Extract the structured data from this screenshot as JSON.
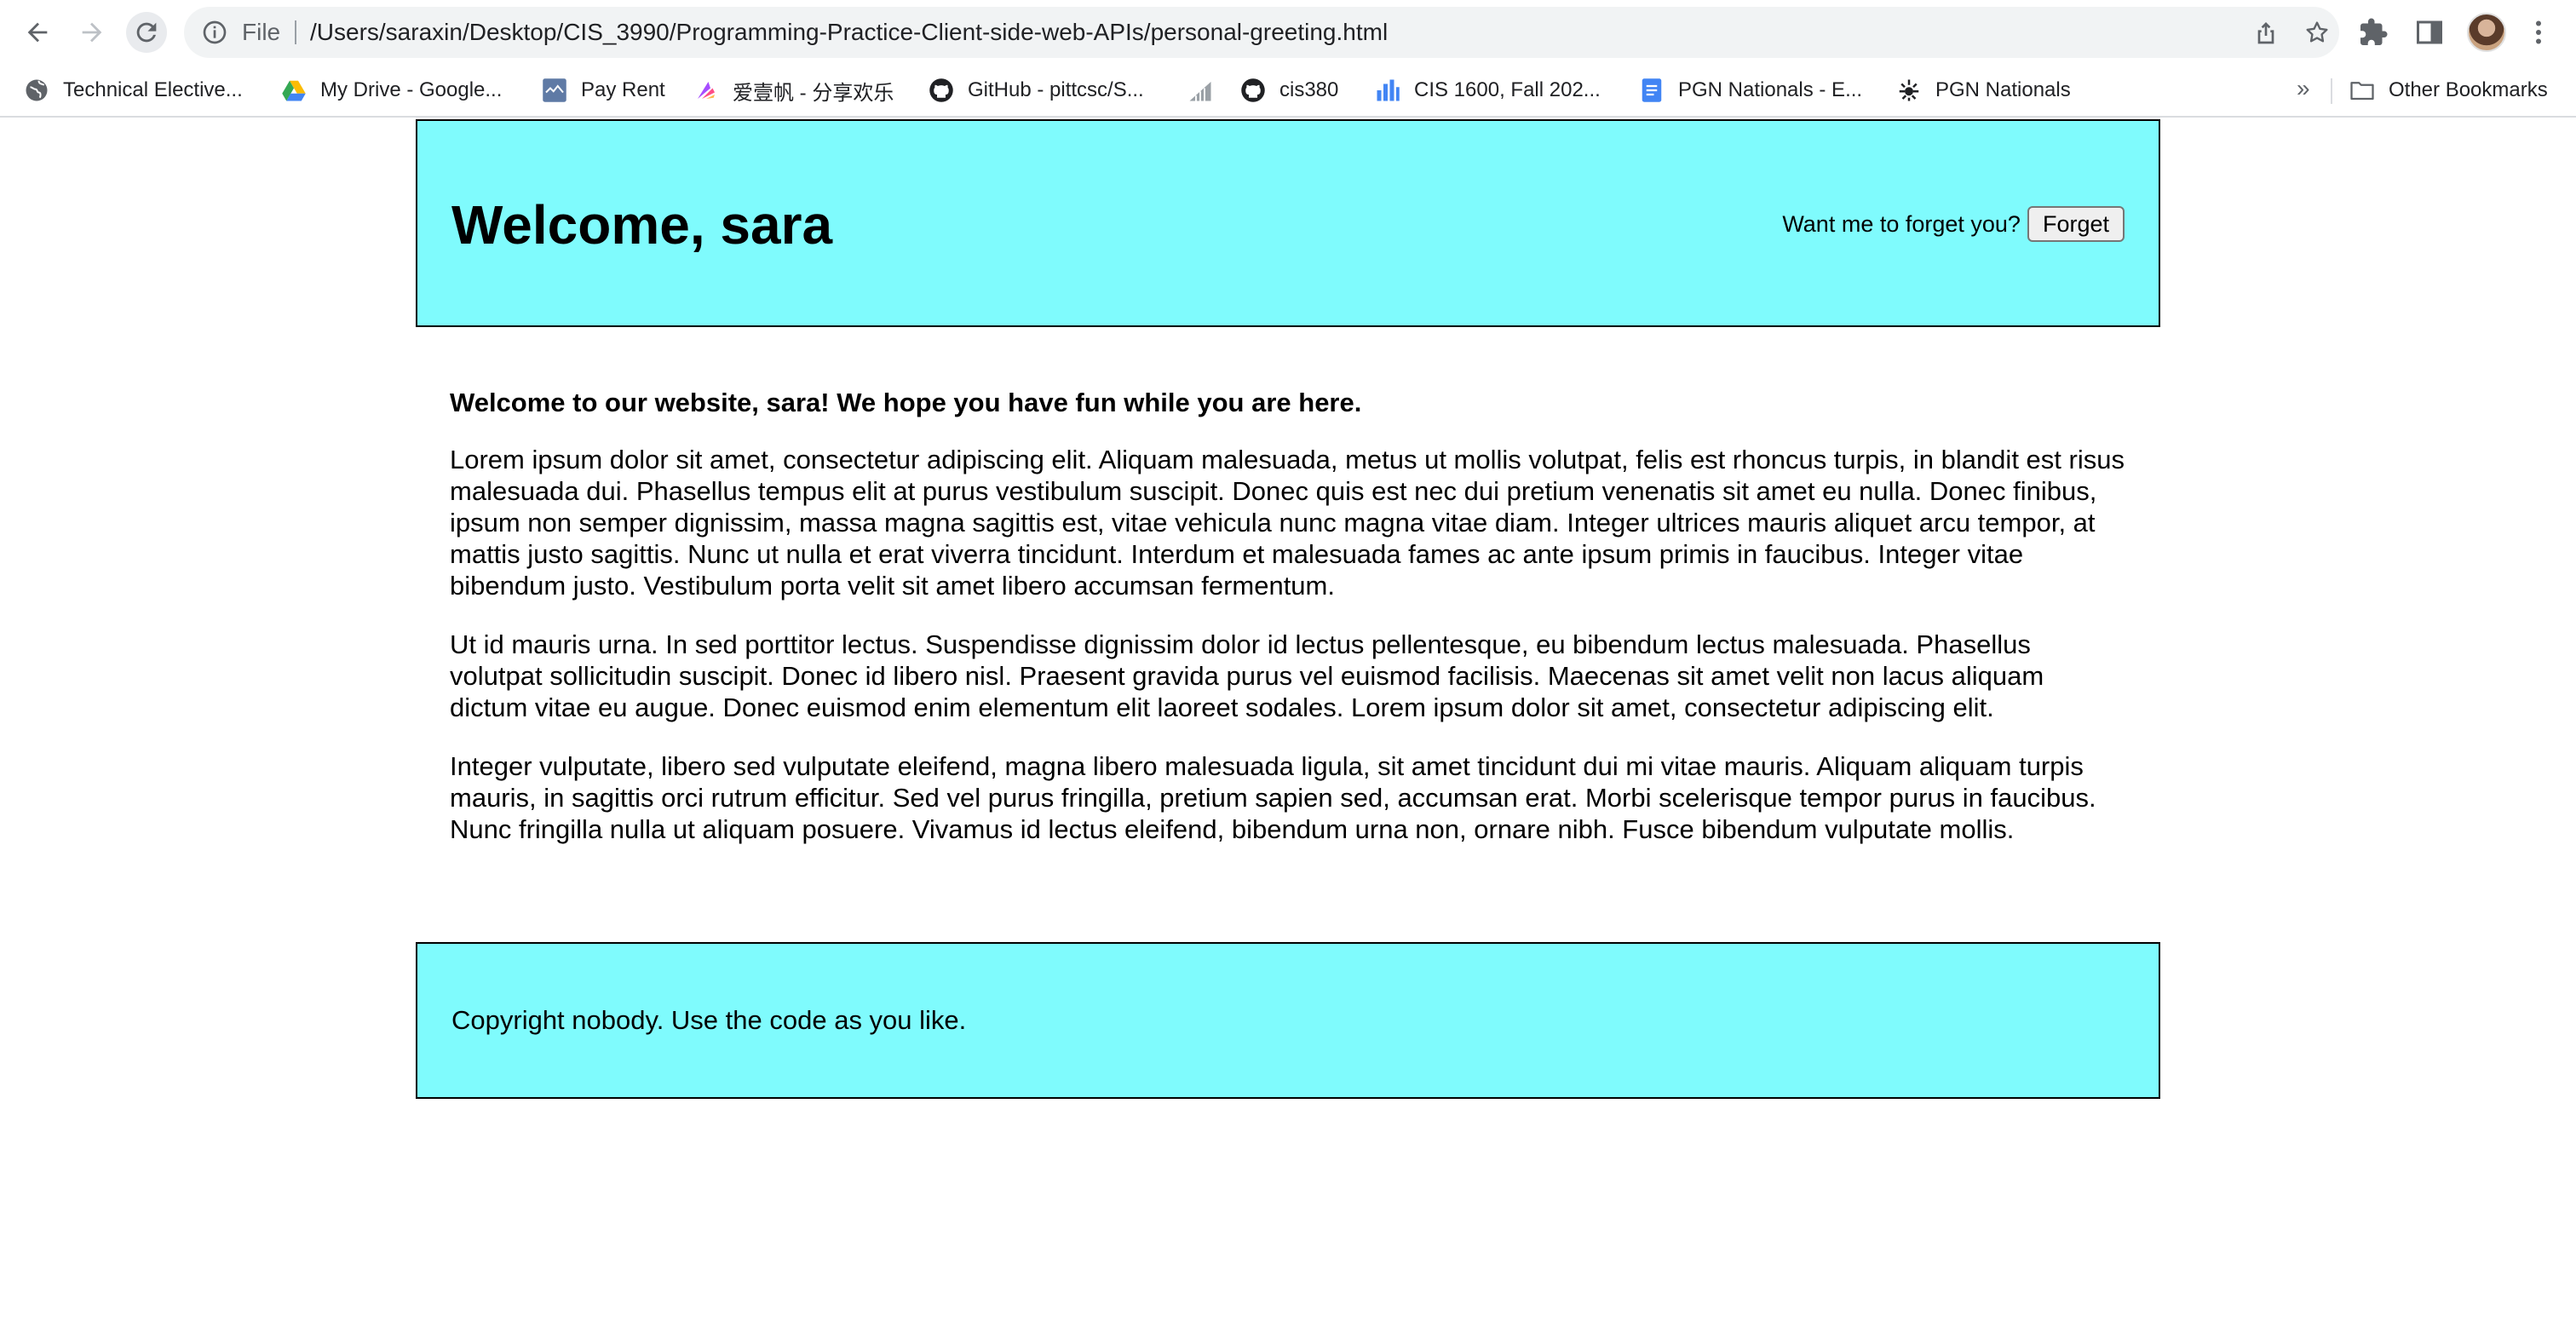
{
  "browser": {
    "omnibox": {
      "scheme_label": "File",
      "url": "/Users/saraxin/Desktop/CIS_3990/Programming-Practice-Client-side-web-APIs/personal-greeting.html"
    },
    "bookmarks": [
      {
        "label": "Technical Elective...",
        "icon": "globe-icon"
      },
      {
        "label": "My Drive - Google...",
        "icon": "google-drive-icon"
      },
      {
        "label": "Pay Rent",
        "icon": "pay-rent-icon"
      },
      {
        "label": "爱壹帆 - 分享欢乐",
        "icon": "aiyifan-icon"
      },
      {
        "label": "GitHub - pittcsc/S...",
        "icon": "github-icon"
      },
      {
        "label": "",
        "icon": "chart-bars-icon"
      },
      {
        "label": "cis380",
        "icon": "github-icon"
      },
      {
        "label": "CIS 1600, Fall 202...",
        "icon": "bar-chart-icon"
      },
      {
        "label": "PGN Nationals - E...",
        "icon": "google-docs-icon"
      },
      {
        "label": "PGN Nationals",
        "icon": "pgn-icon"
      }
    ],
    "overflow_label": "»",
    "other_bookmarks_label": "Other Bookmarks"
  },
  "page": {
    "header": {
      "title": "Welcome, sara",
      "forget_prompt": "Want me to forget you?",
      "forget_button": "Forget"
    },
    "main": {
      "lead": "Welcome to our website, sara! We hope you have fun while you are here.",
      "paragraphs": [
        "Lorem ipsum dolor sit amet, consectetur adipiscing elit. Aliquam malesuada, metus ut mollis volutpat, felis est rhoncus turpis, in blandit est risus malesuada dui. Phasellus tempus elit at purus vestibulum suscipit. Donec quis est nec dui pretium venenatis sit amet eu nulla. Donec finibus, ipsum non semper dignissim, massa magna sagittis est, vitae vehicula nunc magna vitae diam. Integer ultrices mauris aliquet arcu tempor, at mattis justo sagittis. Nunc ut nulla et erat viverra tincidunt. Interdum et malesuada fames ac ante ipsum primis in faucibus. Integer vitae bibendum justo. Vestibulum porta velit sit amet libero accumsan fermentum.",
        "Ut id mauris urna. In sed porttitor lectus. Suspendisse dignissim dolor id lectus pellentesque, eu bibendum lectus malesuada. Phasellus volutpat sollicitudin suscipit. Donec id libero nisl. Praesent gravida purus vel euismod facilisis. Maecenas sit amet velit non lacus aliquam dictum vitae eu augue. Donec euismod enim elementum elit laoreet sodales. Lorem ipsum dolor sit amet, consectetur adipiscing elit.",
        "Integer vulputate, libero sed vulputate eleifend, magna libero malesuada ligula, sit amet tincidunt dui mi vitae mauris. Aliquam aliquam turpis mauris, in sagittis orci rutrum efficitur. Sed vel purus fringilla, pretium sapien sed, accumsan erat. Morbi scelerisque tempor purus in faucibus. Nunc fringilla nulla ut aliquam posuere. Vivamus id lectus eleifend, bibendum urna non, ornare nibh. Fusce bibendum vulputate mollis."
      ]
    },
    "footer": {
      "text": "Copyright nobody. Use the code as you like."
    }
  },
  "colors": {
    "header_background": "#7ffbfd",
    "footer_background": "#7ffbfd",
    "border": "#000000"
  }
}
